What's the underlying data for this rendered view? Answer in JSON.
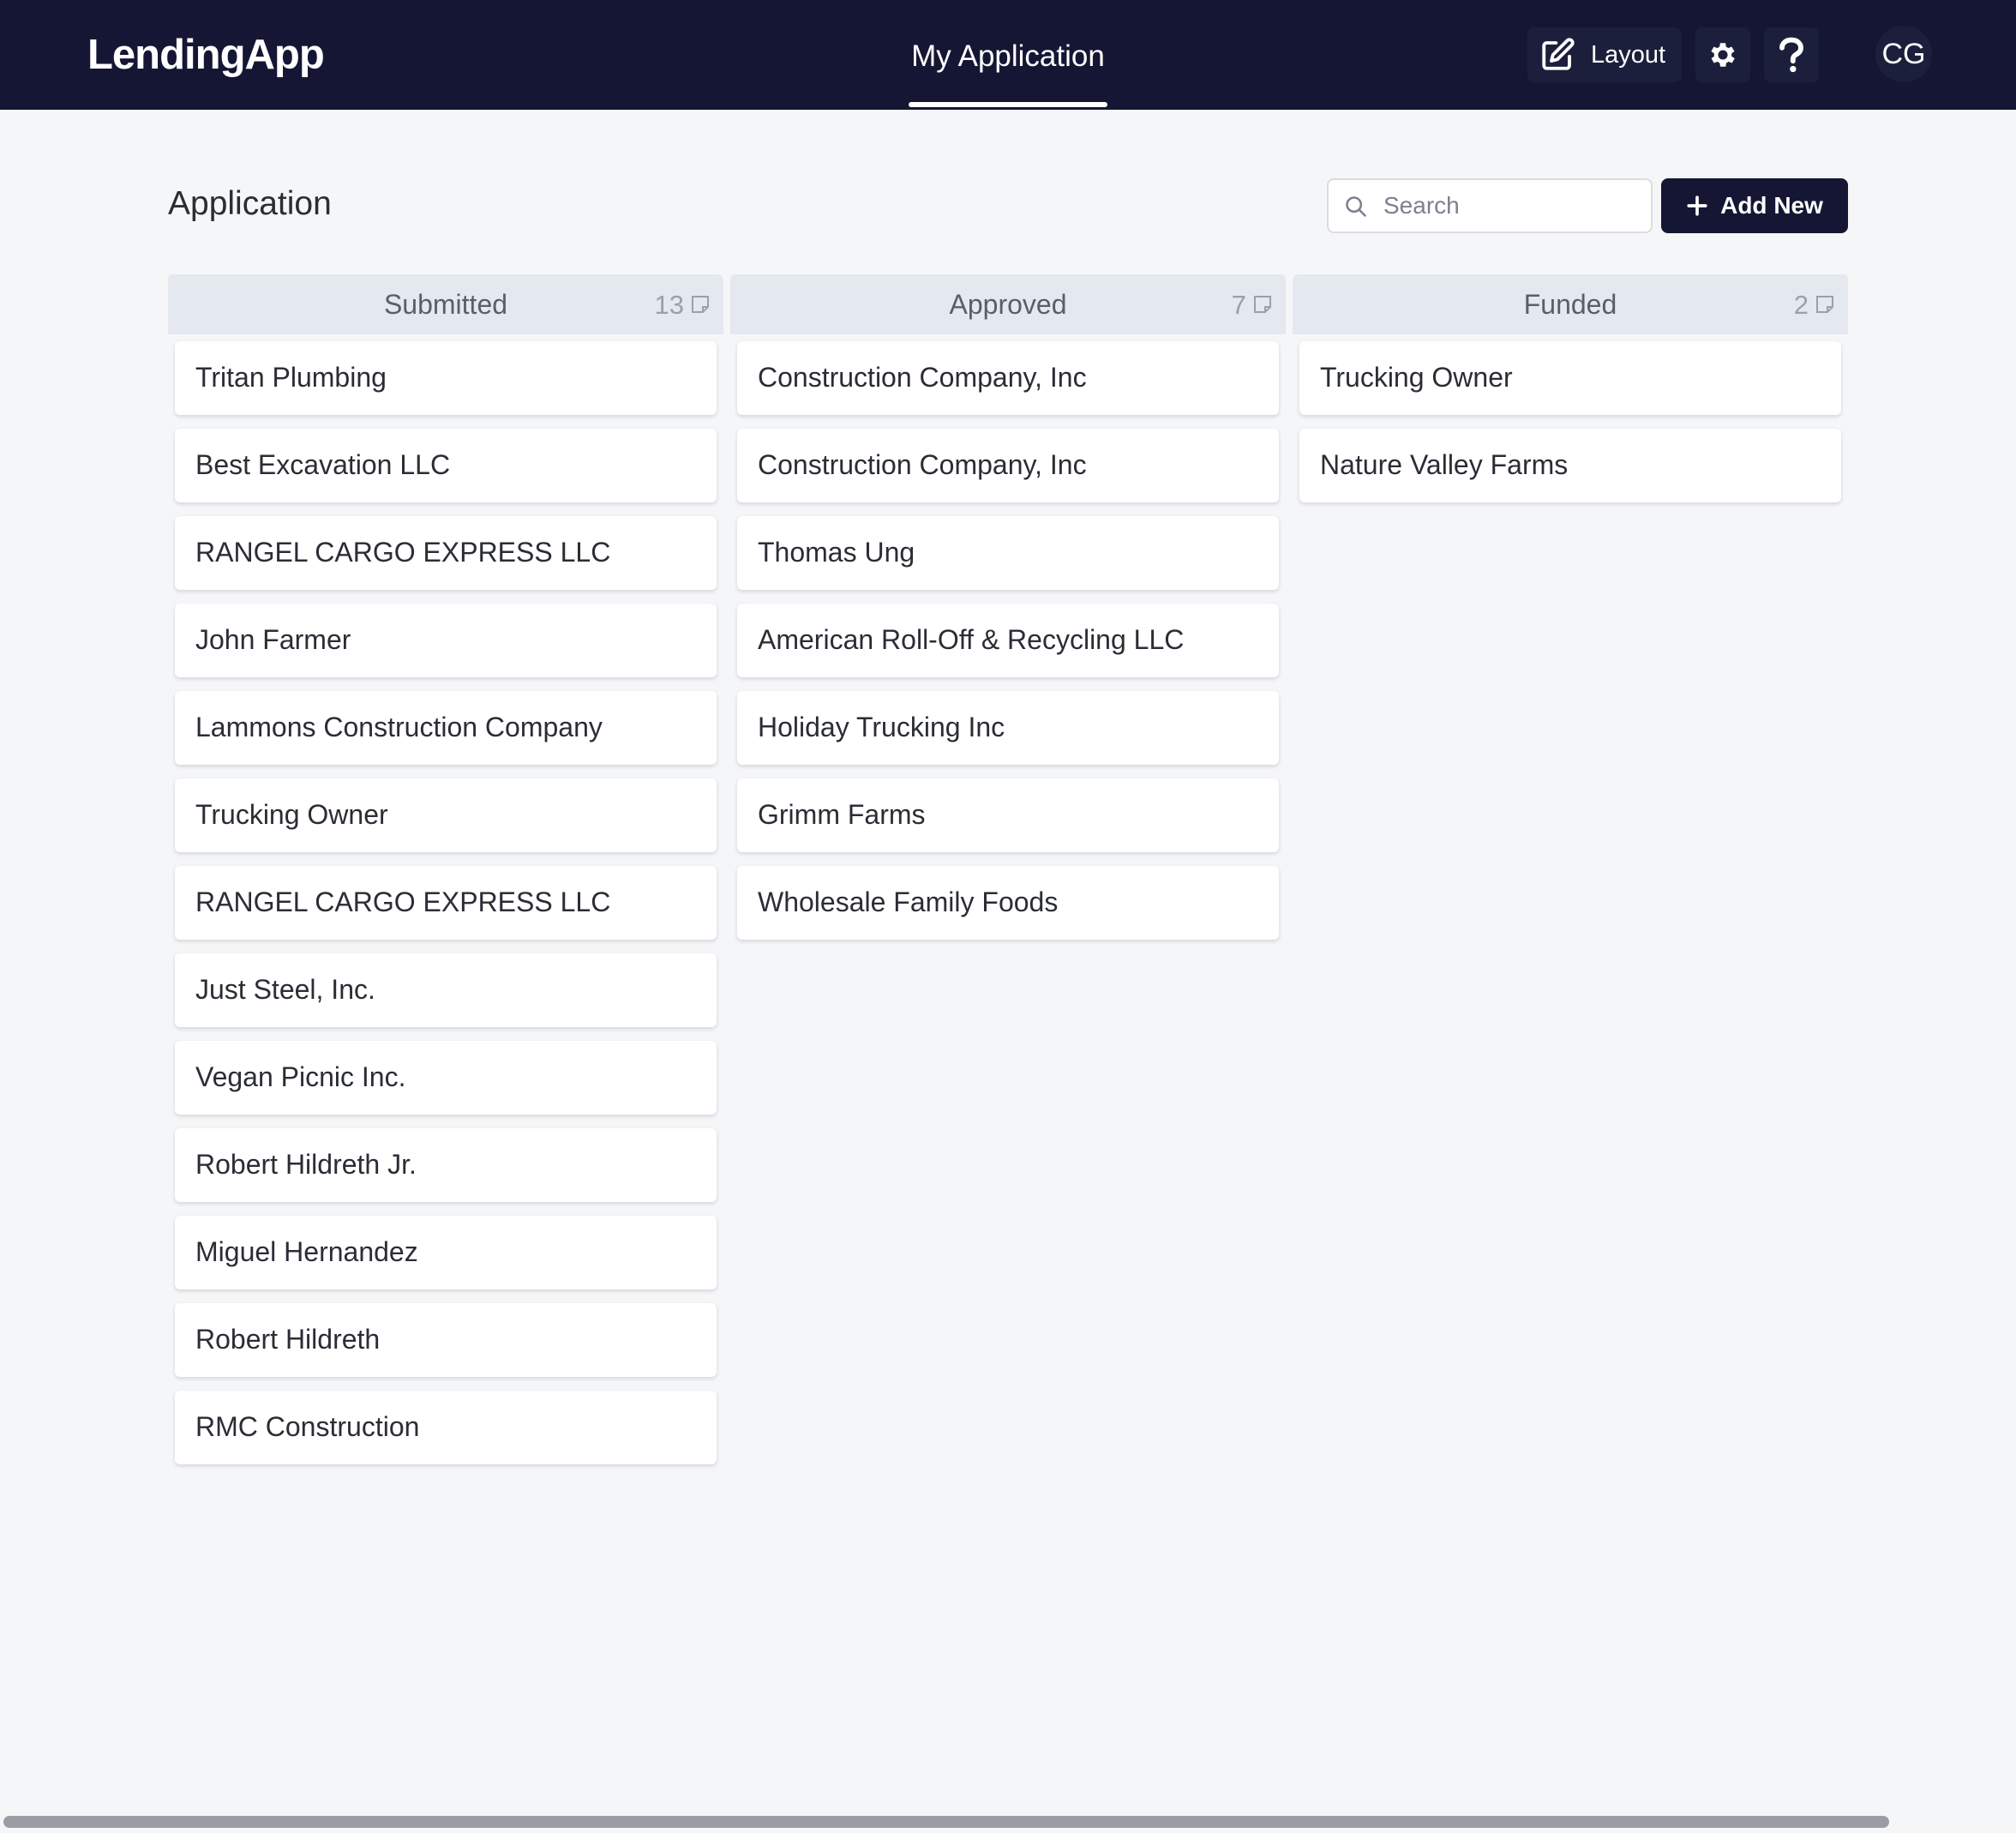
{
  "app": {
    "logo": "LendingApp",
    "nav_tab": "My Application",
    "layout_label": "Layout",
    "avatar_initials": "CG",
    "colors": {
      "topbar": "#141634",
      "accent_button": "#141634",
      "background": "#f5f6f8",
      "column_header": "#e4e8ef"
    }
  },
  "header": {
    "title": "Application",
    "search_placeholder": "Search",
    "add_label": "Add New"
  },
  "columns": [
    {
      "title": "Submitted",
      "count": "13",
      "cards": [
        "Tritan Plumbing",
        "Best Excavation LLC",
        "RANGEL CARGO EXPRESS LLC",
        "John Farmer",
        "Lammons Construction Company",
        "Trucking Owner",
        "RANGEL CARGO EXPRESS LLC",
        "Just Steel, Inc.",
        "Vegan Picnic Inc.",
        "Robert Hildreth Jr.",
        "Miguel Hernandez",
        "Robert Hildreth",
        "RMC Construction"
      ]
    },
    {
      "title": "Approved",
      "count": "7",
      "cards": [
        "Construction Company, Inc",
        "Construction Company, Inc",
        "Thomas Ung",
        "American Roll-Off & Recycling LLC",
        "Holiday Trucking Inc",
        "Grimm Farms",
        "Wholesale Family Foods"
      ]
    },
    {
      "title": "Funded",
      "count": "2",
      "cards": [
        "Trucking Owner",
        "Nature Valley Farms"
      ]
    }
  ]
}
